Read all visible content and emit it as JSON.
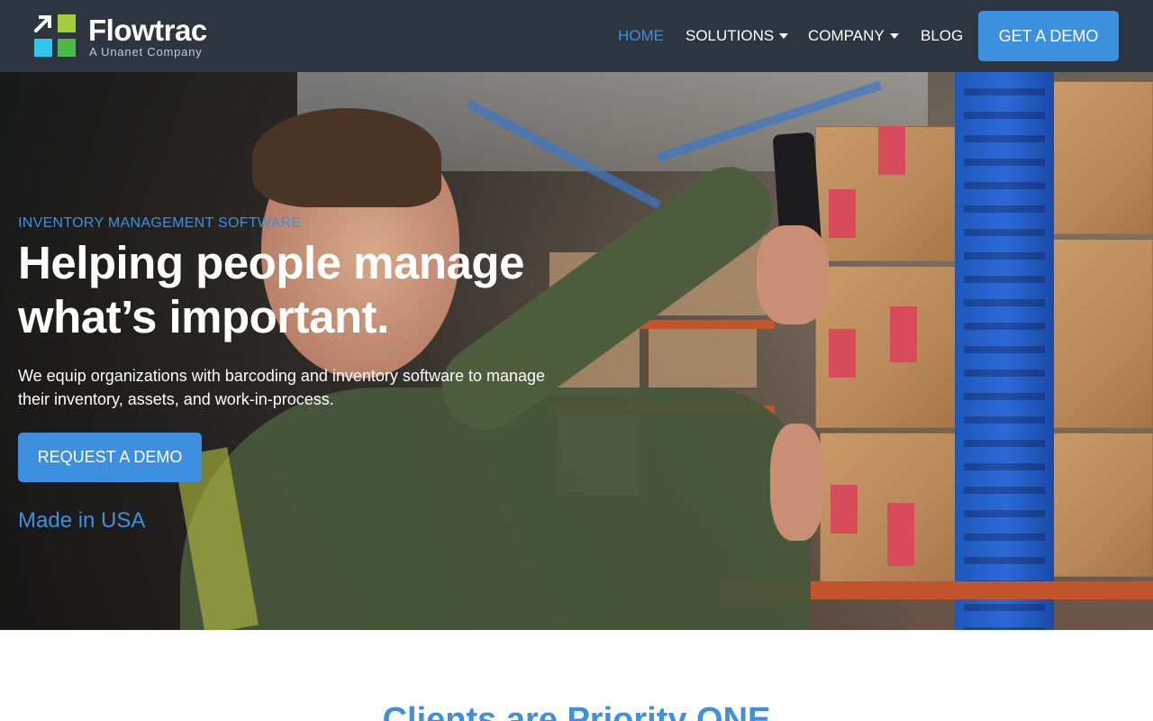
{
  "header": {
    "logo": {
      "name": "Flowtrac",
      "tagline": "A Unanet Company",
      "colors": {
        "arrow": "#ffffff",
        "top_right": "#a3cf3c",
        "bottom_left": "#2fc6ef",
        "bottom_right": "#4cb74a"
      }
    },
    "nav": [
      {
        "label": "HOME",
        "active": true,
        "dropdown": false
      },
      {
        "label": "SOLUTIONS",
        "active": false,
        "dropdown": true
      },
      {
        "label": "COMPANY",
        "active": false,
        "dropdown": true
      },
      {
        "label": "BLOG",
        "active": false,
        "dropdown": false
      }
    ],
    "cta_label": "GET A DEMO"
  },
  "hero": {
    "eyebrow": "INVENTORY MANAGEMENT SOFTWARE",
    "headline": "Helping people manage what’s important.",
    "subtext": "We equip organizations with barcoding and inventory software to manage their inventory, assets, and work-in-process.",
    "cta_label": "REQUEST A DEMO",
    "tagline": "Made in USA"
  },
  "clients": {
    "title": "Clients are Priority ONE"
  },
  "colors": {
    "accent": "#3d8fe0",
    "header_bg": "#2c3540",
    "text_light": "#ffffff"
  }
}
